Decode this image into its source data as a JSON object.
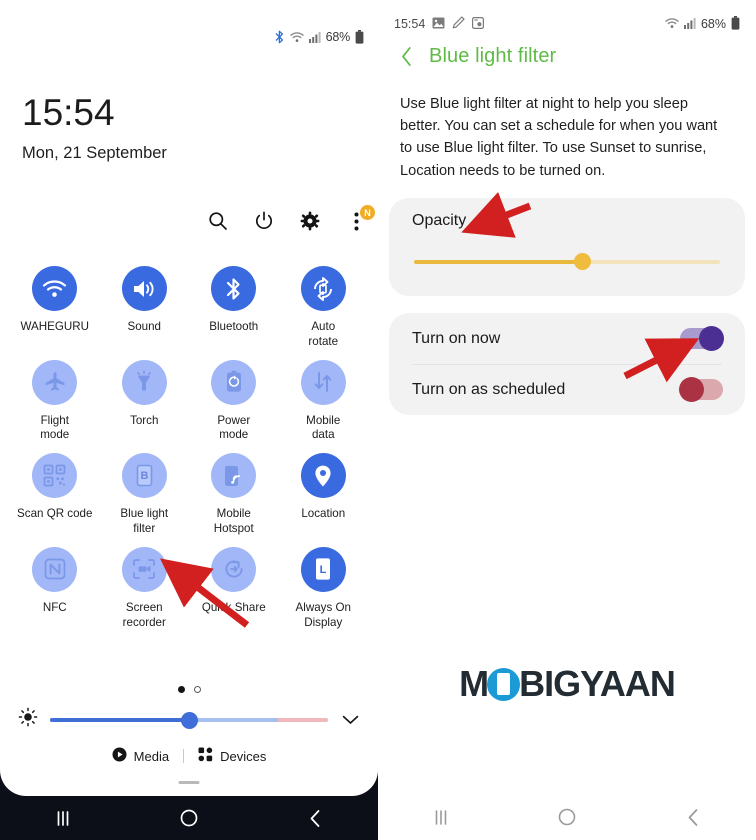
{
  "left_panel": {
    "status_bar": {
      "battery_text": "68%",
      "icons": [
        "bluetooth-icon",
        "wifi-icon",
        "signal-icon",
        "battery-icon"
      ]
    },
    "clock": {
      "time": "15:54",
      "date": "Mon, 21 September"
    },
    "actions": [
      {
        "name": "search-icon",
        "label": "Search"
      },
      {
        "name": "power-icon",
        "label": "Power"
      },
      {
        "name": "settings-gear-icon",
        "label": "Settings"
      },
      {
        "name": "more-options-icon",
        "label": "More options",
        "badge": "N"
      }
    ],
    "tiles": [
      {
        "label": "WAHEGURU",
        "icon": "wifi-icon",
        "state": "on"
      },
      {
        "label": "Sound",
        "icon": "sound-icon",
        "state": "on"
      },
      {
        "label": "Bluetooth",
        "icon": "bluetooth-icon",
        "state": "on"
      },
      {
        "label": "Auto\nrotate",
        "icon": "auto-rotate-icon",
        "state": "on"
      },
      {
        "label": "Flight\nmode",
        "icon": "flight-mode-icon",
        "state": "off"
      },
      {
        "label": "Torch",
        "icon": "torch-icon",
        "state": "off"
      },
      {
        "label": "Power\nmode",
        "icon": "power-mode-icon",
        "state": "off"
      },
      {
        "label": "Mobile\ndata",
        "icon": "mobile-data-icon",
        "state": "off"
      },
      {
        "label": "Scan QR code",
        "icon": "qr-code-icon",
        "state": "off"
      },
      {
        "label": "Blue light\nfilter",
        "icon": "blue-light-filter-icon",
        "state": "off"
      },
      {
        "label": "Mobile\nHotspot",
        "icon": "mobile-hotspot-icon",
        "state": "off"
      },
      {
        "label": "Location",
        "icon": "location-pin-icon",
        "state": "on"
      },
      {
        "label": "NFC",
        "icon": "nfc-icon",
        "state": "off"
      },
      {
        "label": "Screen\nrecorder",
        "icon": "screen-recorder-icon",
        "state": "off"
      },
      {
        "label": "Quick Share",
        "icon": "quick-share-icon",
        "state": "off"
      },
      {
        "label": "Always On\nDisplay",
        "icon": "always-on-display-icon",
        "state": "on"
      }
    ],
    "page_indicator": {
      "total": 2,
      "active": 1
    },
    "brightness": {
      "value_percent": 50,
      "secondary_percent": 82,
      "icon": "brightness-icon",
      "expand_icon": "chevron-down-icon"
    },
    "footer": [
      {
        "label": "Media",
        "icon": "media-play-icon"
      },
      {
        "label": "Devices",
        "icon": "devices-grid-icon"
      }
    ],
    "nav_bar": [
      {
        "name": "recents-button",
        "glyph": "|||"
      },
      {
        "name": "home-button",
        "glyph": "O"
      },
      {
        "name": "back-button",
        "glyph": "<"
      }
    ]
  },
  "right_panel": {
    "status_bar": {
      "time": "15:54",
      "battery_text": "68%",
      "left_icons": [
        "gallery-icon",
        "pen-tool-icon",
        "screenshot-icon"
      ],
      "right_icons": [
        "wifi-icon",
        "signal-icon",
        "battery-icon"
      ]
    },
    "header": {
      "back_icon": "back-chevron-icon",
      "title": "Blue light filter"
    },
    "description": "Use Blue light filter at night to help you sleep better. You can set a schedule for when you want to use Blue light filter. To use Sunset to sunrise, Location needs to be turned on.",
    "opacity": {
      "label": "Opacity",
      "value_percent": 55
    },
    "switches": [
      {
        "label": "Turn on now",
        "state": "on"
      },
      {
        "label": "Turn on as scheduled",
        "state": "off"
      }
    ],
    "watermark": {
      "text_before": "M",
      "text_after": "BIGYAAN",
      "full": "MOBIGYAAN"
    },
    "nav_bar": [
      {
        "name": "recents-button",
        "glyph": "|||"
      },
      {
        "name": "home-button",
        "glyph": "O"
      },
      {
        "name": "back-button",
        "glyph": "<"
      }
    ]
  },
  "annotations": {
    "arrow_color": "#d21f1f",
    "arrows": [
      {
        "name": "arrow-to-blue-light-filter"
      },
      {
        "name": "arrow-to-opacity"
      },
      {
        "name": "arrow-to-turn-on-now-toggle"
      }
    ]
  }
}
